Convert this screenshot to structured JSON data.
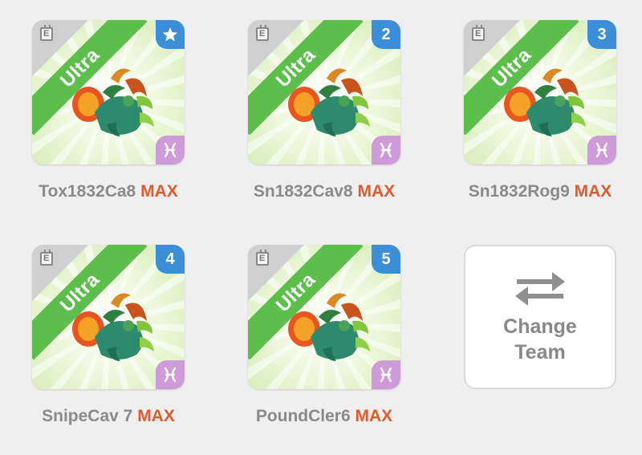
{
  "team": {
    "slots": [
      {
        "name": "Tox1832Ca8",
        "level": "MAX",
        "rarity": "Ultra",
        "badge": "star",
        "badge_kind": "star-icon",
        "element_icon": "pisces-icon"
      },
      {
        "name": "Sn1832Cav8",
        "level": "MAX",
        "rarity": "Ultra",
        "badge": "2",
        "badge_kind": "number",
        "element_icon": "pisces-icon"
      },
      {
        "name": "Sn1832Rog9",
        "level": "MAX",
        "rarity": "Ultra",
        "badge": "3",
        "badge_kind": "number",
        "element_icon": "pisces-icon"
      },
      {
        "name": "SnipeCav 7",
        "level": "MAX",
        "rarity": "Ultra",
        "badge": "4",
        "badge_kind": "number",
        "element_icon": "pisces-icon"
      },
      {
        "name": "PoundCler6",
        "level": "MAX",
        "rarity": "Ultra",
        "badge": "5",
        "badge_kind": "number",
        "element_icon": "pisces-icon"
      }
    ],
    "change_team": {
      "label_line1": "Change",
      "label_line2": "Team",
      "icon": "swap-arrows-icon"
    }
  },
  "colors": {
    "background": "#efefef",
    "rarity_band": "#5cbf4b",
    "position_badge": "#3a8fd8",
    "element_badge": "#cf9ad8",
    "max_text": "#e25a2b",
    "name_text": "#8a8a8a"
  }
}
